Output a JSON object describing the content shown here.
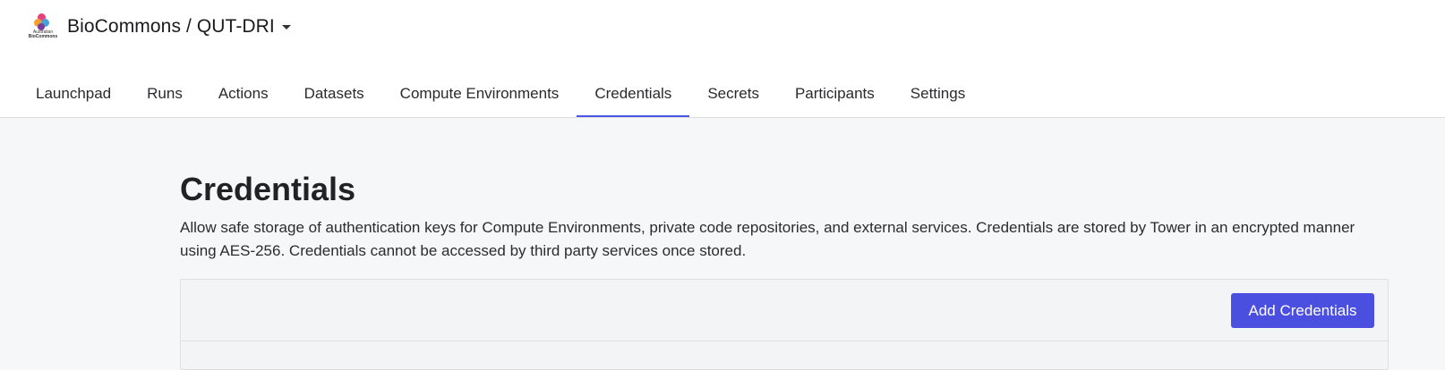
{
  "header": {
    "logo_text_line1": "Australian",
    "logo_text_line2": "BioCommons",
    "org_name": "BioCommons / QUT-DRI"
  },
  "tabs": [
    {
      "label": "Launchpad",
      "active": false
    },
    {
      "label": "Runs",
      "active": false
    },
    {
      "label": "Actions",
      "active": false
    },
    {
      "label": "Datasets",
      "active": false
    },
    {
      "label": "Compute Environments",
      "active": false
    },
    {
      "label": "Credentials",
      "active": true
    },
    {
      "label": "Secrets",
      "active": false
    },
    {
      "label": "Participants",
      "active": false
    },
    {
      "label": "Settings",
      "active": false
    }
  ],
  "page": {
    "title": "Credentials",
    "description": "Allow safe storage of authentication keys for Compute Environments, private code repositories, and external services. Credentials are stored by Tower in an encrypted manner using AES-256. Credentials cannot be accessed by third party services once stored."
  },
  "panel": {
    "add_button_label": "Add Credentials"
  },
  "colors": {
    "accent": "#4b4fe0",
    "active_tab_underline": "#4f57e6",
    "background": "#f6f7f9"
  }
}
